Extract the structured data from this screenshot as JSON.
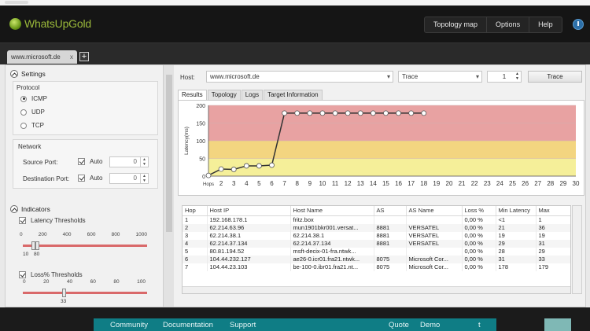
{
  "app": {
    "title": "WhatsUpGold"
  },
  "nav": {
    "topology": "Topology map",
    "options": "Options",
    "help": "Help"
  },
  "doc_tab": {
    "label": "www.microsoft.de",
    "close": "x",
    "add": "+"
  },
  "settings": {
    "title": "Settings",
    "protocol_label": "Protocol",
    "protocols": [
      "ICMP",
      "UDP",
      "TCP"
    ],
    "selected_protocol": "ICMP",
    "network_label": "Network",
    "source_port_label": "Source Port:",
    "dest_port_label": "Destination Port:",
    "auto_label": "Auto",
    "source_port_value": "0",
    "dest_port_value": "0"
  },
  "indicators": {
    "title": "Indicators",
    "latency_label": "Latency Thresholds",
    "latency_ticks": [
      "0",
      "200",
      "400",
      "600",
      "800",
      "1000"
    ],
    "latency_low_values": [
      "10",
      "80"
    ],
    "loss_label": "Loss% Thresholds",
    "loss_ticks": [
      "0",
      "20",
      "40",
      "60",
      "80",
      "100"
    ],
    "loss_value": "33"
  },
  "toolbar": {
    "host_label": "Host:",
    "host_value": "www.microsoft.de",
    "mode_value": "Trace",
    "count_value": "1",
    "trace_button": "Trace"
  },
  "tabs": [
    "Results",
    "Topology",
    "Logs",
    "Target Information"
  ],
  "chart_data": {
    "type": "line",
    "ylabel": "Latency(ms)",
    "xlabel": "Hops",
    "ylim": [
      0,
      200
    ],
    "yticks": [
      0,
      50,
      100,
      150,
      200
    ],
    "xlim": [
      1,
      30
    ],
    "xticks": [
      "Hops",
      "2",
      "3",
      "4",
      "5",
      "6",
      "7",
      "8",
      "9",
      "10",
      "11",
      "12",
      "13",
      "14",
      "15",
      "16",
      "17",
      "18",
      "19",
      "20",
      "21",
      "22",
      "23",
      "24",
      "25",
      "26",
      "27",
      "28",
      "29",
      "30"
    ],
    "bands": [
      {
        "from": 0,
        "to": 50,
        "color": "#f5ef99"
      },
      {
        "from": 50,
        "to": 100,
        "color": "#f3d580"
      },
      {
        "from": 100,
        "to": 200,
        "color": "#e8a2a2"
      }
    ],
    "series": [
      {
        "x": [
          1,
          2,
          3,
          4,
          5,
          6,
          7,
          8,
          9,
          10,
          11,
          12,
          13,
          14,
          15,
          16,
          17,
          18
        ],
        "values": [
          2,
          20,
          19,
          29,
          29,
          31,
          178,
          178,
          178,
          178,
          178,
          178,
          178,
          178,
          178,
          178,
          178,
          178
        ]
      }
    ],
    "grid": true
  },
  "table": {
    "columns": [
      "Hop",
      "Host IP",
      "Host Name",
      "AS",
      "AS Name",
      "Loss %",
      "Min Latency",
      "Max"
    ],
    "rows": [
      [
        "1",
        "192.168.178.1",
        "fritz.box",
        "",
        "",
        "0,00 %",
        "<1",
        "1"
      ],
      [
        "2",
        "62.214.63.96",
        "mun1901bkr001.versat...",
        "8881",
        "VERSATEL",
        "0,00 %",
        "21",
        "36"
      ],
      [
        "3",
        "62.214.38.1",
        "62.214.38.1",
        "8881",
        "VERSATEL",
        "0,00 %",
        "19",
        "19"
      ],
      [
        "4",
        "62.214.37.134",
        "62.214.37.134",
        "8881",
        "VERSATEL",
        "0,00 %",
        "29",
        "31"
      ],
      [
        "5",
        "80.81.194.52",
        "msft-decix-01-fra.ntwk...",
        "",
        "",
        "0,00 %",
        "28",
        "29"
      ],
      [
        "6",
        "104.44.232.127",
        "ae26-0.icr01.fra21.ntwk...",
        "8075",
        "Microsoft Cor...",
        "0,00 %",
        "31",
        "33"
      ],
      [
        "7",
        "104.44.23.103",
        "be-100-0.ibr01.fra21.nt...",
        "8075",
        "Microsoft Cor...",
        "0,00 %",
        "178",
        "179"
      ]
    ]
  },
  "footer": {
    "community": "Community",
    "documentation": "Documentation",
    "support": "Support",
    "quote": "Quote",
    "demo": "Demo",
    "last": "t"
  }
}
